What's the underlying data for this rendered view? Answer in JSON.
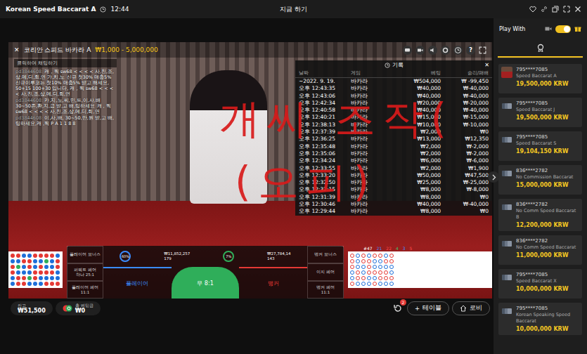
{
  "window": {
    "title": "Korean Speed Baccarat A",
    "time": "12:44",
    "label": "지금 하기"
  },
  "game": {
    "close": "✕",
    "title": "코리안 스피드 바카라 A",
    "limits": "₩1,000 - 5,000,000",
    "help": "?"
  },
  "chat": {
    "placeholder": "클릭하여 채팅하기",
    "messages": [
      {
        "user": "pd3844608:",
        "text": "캐 , 찍 sw68 < < < < 사,친,조,상,메,디,회,연 가,치,노 신규 첫30% 매충5% 신규이루코는 첫10% 매충5% 받고 해세요, 50+15 100+30 입니다, 캐 , 찍 sw68 < < < < 사,친,조,상,메,디,회,연"
      },
      {
        "user": "pd3844608:",
        "text": "카,지,노,씨,민,트,이,사,배 30~50존,환,지,급 받,고 배,팅하세요 캐 , 찍 sw68 < < < < 사,친,조,상,메,디,회,연"
      },
      {
        "user": "pd3844608:",
        "text": "이,사,배, 30~50,만,원 받,고 배,팅하세요,캐 ,찍 P A 1 1 8 8"
      }
    ]
  },
  "history": {
    "title": "기록",
    "close": "✕",
    "columns": [
      "날짜",
      "게임",
      "베팅",
      "승리/패배"
    ],
    "rows": [
      [
        "~2022. 9. 19.",
        "바카라",
        "₩504,000",
        "₩ -99,450"
      ],
      [
        "오후 12:43:35",
        "바카라",
        "₩40,000",
        "₩-40,000"
      ],
      [
        "오후 12:43:06",
        "바카라",
        "₩40,000",
        "₩-40,000"
      ],
      [
        "오후 12:42:34",
        "바카라",
        "₩20,000",
        "₩-20,000"
      ],
      [
        "오후 12:40:58",
        "바카라",
        "₩40,000",
        "₩-40,000"
      ],
      [
        "오후 12:40:21",
        "바카라",
        "₩15,000",
        "₩-15,000"
      ],
      [
        "오후 12:38:13",
        "바카라",
        "₩10,000",
        "₩-10,000"
      ],
      [
        "오후 12:37:39",
        "바카라",
        "₩2,000",
        "₩0"
      ],
      [
        "오후 12:36:25",
        "바카라",
        "₩13,000",
        "₩12,350"
      ],
      [
        "오후 12:35:48",
        "바카라",
        "₩2,000",
        "₩-2,000"
      ],
      [
        "오후 12:35:06",
        "바카라",
        "₩2,000",
        "₩-2,000"
      ],
      [
        "오후 12:34:24",
        "바카라",
        "₩6,000",
        "₩-6,000"
      ],
      [
        "오후 12:33:55",
        "바카라",
        "₩2,000",
        "₩1,900"
      ],
      [
        "오후 12:33:20",
        "바카라",
        "₩50,000",
        "₩47,500"
      ],
      [
        "오후 12:32:50",
        "바카라",
        "₩25,000",
        "₩-25,000"
      ],
      [
        "오후 12:32:15",
        "바카라",
        "₩8,000",
        "₩-8,000"
      ],
      [
        "오후 12:31:39",
        "바카라",
        "₩8,000",
        "₩0"
      ],
      [
        "오후 12:30:46",
        "바카라",
        "₩40,000",
        "₩-40,000"
      ],
      [
        "오후 12:29:44",
        "바카라",
        "₩8,000",
        "₩0"
      ]
    ]
  },
  "scribbles": [
    "개씨 조작(",
    "(오피)"
  ],
  "roads": {
    "bead": [
      "B",
      "P",
      "B",
      "B",
      "P",
      "P",
      "B",
      "P",
      "T",
      "P",
      "B",
      "B",
      "P",
      "B",
      "P",
      "P",
      "B",
      "B",
      "P",
      "B",
      "B",
      "P",
      "T",
      "P",
      "B",
      "P",
      "P",
      "B",
      "B",
      "P",
      "B",
      "P",
      "B",
      "B",
      "P",
      "P",
      "B",
      "T",
      "P",
      "B",
      "P",
      "B",
      "B",
      "P",
      "P",
      "B",
      "P",
      "B",
      "P",
      "B",
      "B",
      "P",
      "P",
      "B"
    ],
    "big": [
      "B",
      "B",
      "B",
      "P",
      "P",
      "B",
      "P",
      "P",
      "P",
      "B",
      "B",
      "P",
      "B",
      "B",
      "P",
      "P",
      "B",
      "P",
      "P",
      "B",
      "B",
      "B",
      "P",
      "P",
      "B",
      "P",
      "P",
      "B",
      "P",
      "B",
      "B",
      "P",
      "P",
      "B",
      "B",
      "P",
      "P",
      "B",
      "P",
      "B",
      "B",
      "P",
      "B",
      "B",
      "P",
      "P",
      "B",
      "P"
    ]
  },
  "road_stats": [
    {
      "text": "#47",
      "color": "#ffffff"
    },
    {
      "text": "21",
      "color": "#3b8cff"
    },
    {
      "text": "22",
      "color": "#ff4b4b"
    },
    {
      "text": "4",
      "color": "#39c06a"
    },
    {
      "text": "3",
      "color": "#3b8cff"
    },
    {
      "text": "5",
      "color": "#ff4b4b"
    }
  ],
  "board": {
    "left_bets": [
      [
        "플레이어 보너스"
      ],
      [
        "퍼펙트 페어",
        "하나 25:1"
      ],
      [
        "플레이어 페어",
        "11:1"
      ]
    ],
    "right_bets": [
      [
        "뱅커 보너스"
      ],
      [
        "이지 페어"
      ],
      [
        "뱅커 페어",
        "11:1"
      ]
    ],
    "player_pct": "60%",
    "player_amount": "₩11,852,257",
    "player_count": "179",
    "tie_pct": "7%",
    "banker_amount": "₩27,784,14",
    "banker_count": "143",
    "main_bets": [
      {
        "label": "플레이어",
        "color": "#3b8cff"
      },
      {
        "label": "무 8:1",
        "color": "#2fae5a"
      },
      {
        "label": "뱅커",
        "color": "#e53935"
      }
    ]
  },
  "controls": {
    "balance_label": "잔고",
    "balance": "₩51,500",
    "bet_label": "총 베팅금",
    "bet": "₩0",
    "badge": "2",
    "table_plus": "+",
    "table": "테이블",
    "lobby": "로비"
  },
  "sidebar": {
    "title": "Play With",
    "toggle_on": true,
    "tabs": [
      {
        "selected": true
      }
    ],
    "tables": [
      {
        "player": "795****7085",
        "game": "Speed Baccarat A",
        "amount": "19,500,000 KRW",
        "kind": "photo"
      },
      {
        "player": "795****7085",
        "game": "Speed Baccarat J",
        "amount": "19,500,000 KRW",
        "kind": "cards"
      },
      {
        "player": "795****7085",
        "game": "Speed Baccarat S",
        "amount": "19,104,150 KRW",
        "kind": "cards"
      },
      {
        "player": "836****2782",
        "game": "No Commission Baccarat",
        "amount": "15,000,000 KRW",
        "kind": "cards"
      },
      {
        "player": "836****2782",
        "game": "No Comm Speed Baccarat B",
        "amount": "12,200,000 KRW",
        "kind": "cards"
      },
      {
        "player": "836****2782",
        "game": "No Comm Speed Baccarat",
        "amount": "11,000,000 KRW",
        "kind": "cards"
      },
      {
        "player": "795****7085",
        "game": "Speed Baccarat X",
        "amount": "10,000,000 KRW",
        "kind": "cards"
      },
      {
        "player": "795****7085",
        "game": "Korean Speaking Speed Baccarat",
        "amount": "10,000,000 KRW",
        "kind": "cards"
      }
    ]
  }
}
